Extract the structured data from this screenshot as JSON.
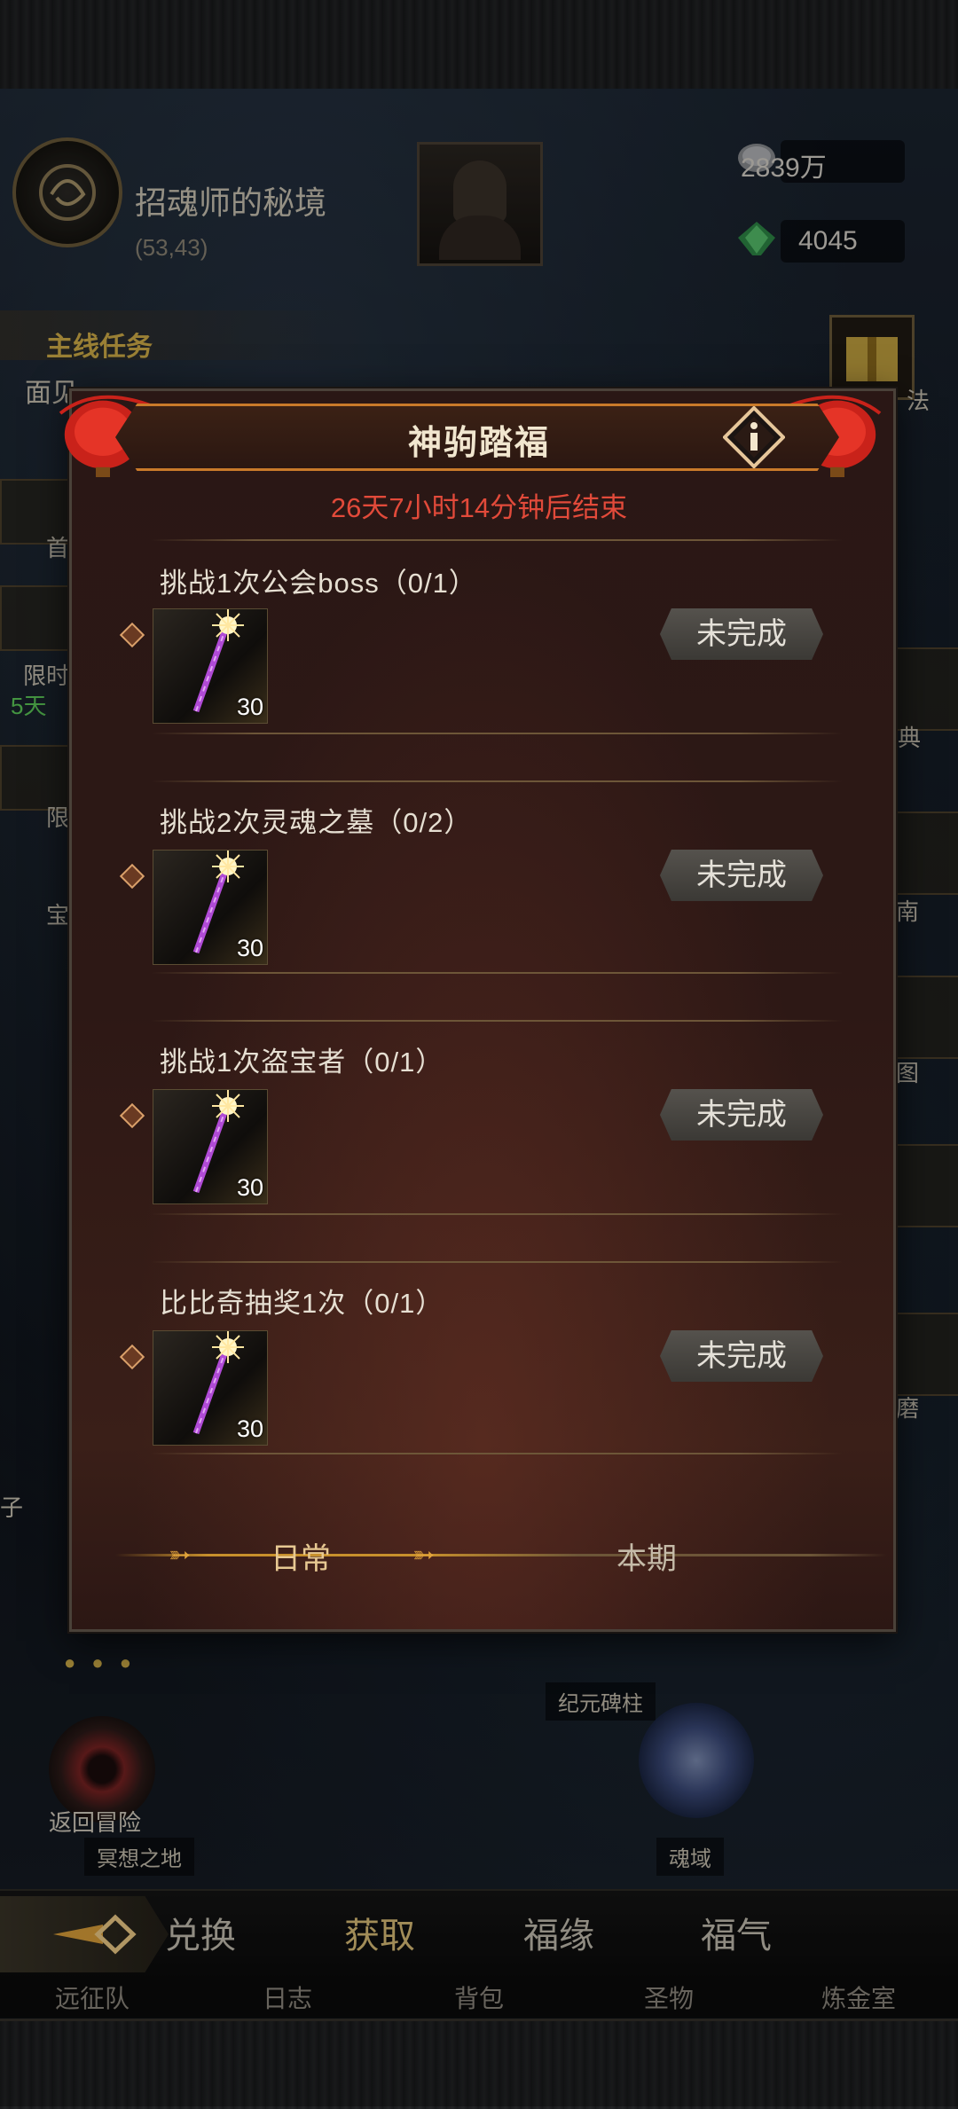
{
  "location": {
    "name": "招魂师的秘境",
    "coords": "(53,43)"
  },
  "resources": [
    {
      "icon": "silver-coin-icon",
      "value": "2839万"
    },
    {
      "icon": "green-gem-icon",
      "value": "4045"
    }
  ],
  "quest_panel": {
    "title": "主线任务",
    "partial_text": "面见"
  },
  "background_labels": {
    "right_1": "法",
    "right_2": "典",
    "right_3": "南",
    "left_1": "首",
    "left_2": "限时",
    "left_2_timer": "5天",
    "left_3": "限",
    "left_4": "宝",
    "left_5": "子",
    "right_4": "图",
    "right_5": "磨",
    "pillar": "纪元碑柱",
    "dreamland": "冥想之地",
    "soul_domain": "魂域",
    "return_adventure": "返回冒险"
  },
  "modal": {
    "title": "神驹踏福",
    "countdown": "26天7小时14分钟后结束",
    "tasks": [
      {
        "title": "挑战1次公会boss（0/1）",
        "reward_qty": "30",
        "status": "未完成"
      },
      {
        "title": "挑战2次灵魂之墓（0/2）",
        "reward_qty": "30",
        "status": "未完成"
      },
      {
        "title": "挑战1次盗宝者（0/1）",
        "reward_qty": "30",
        "status": "未完成"
      },
      {
        "title": "比比奇抽奖1次（0/1）",
        "reward_qty": "30",
        "status": "未完成"
      }
    ],
    "tabs": {
      "daily": "日常",
      "period": "本期"
    }
  },
  "bottom_tabs": [
    "兑换",
    "获取",
    "福缘",
    "福气"
  ],
  "bottom_tabs_active": "获取",
  "bottom_nav": [
    "远征队",
    "日志",
    "背包",
    "圣物",
    "炼金室"
  ],
  "colors": {
    "accent_gold": "#c8902c",
    "countdown_red": "#e24a3a",
    "status_gray": "#4a4843"
  }
}
